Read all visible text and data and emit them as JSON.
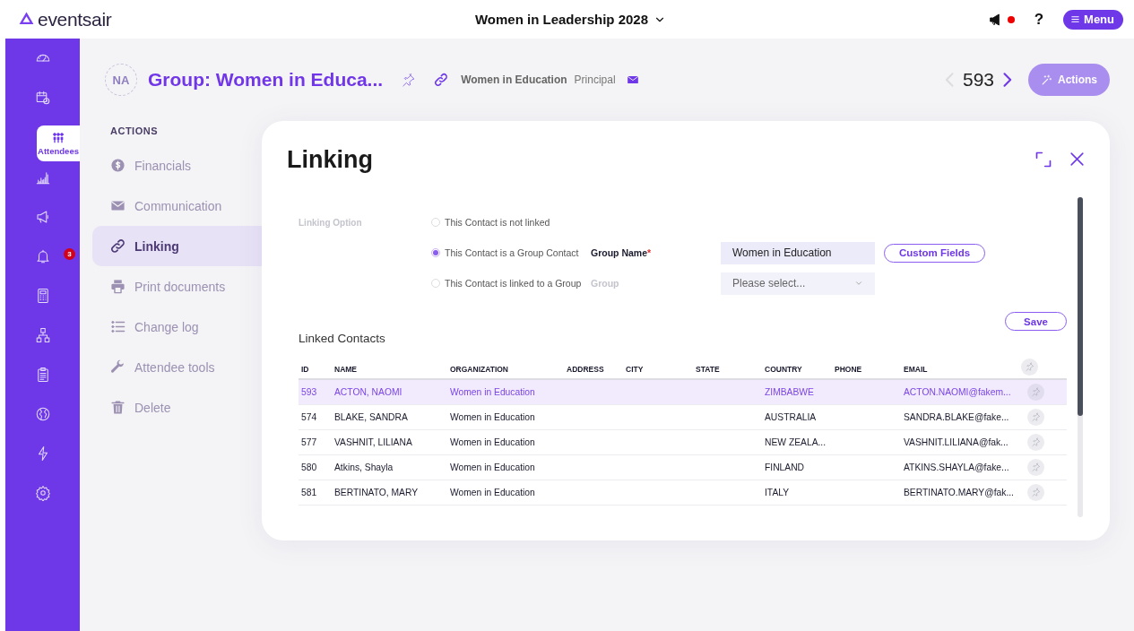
{
  "top_bar": {
    "logo": "eventsair",
    "event_title": "Women in Leadership 2028",
    "has_notification": true,
    "help": "?",
    "menu_button": "Menu"
  },
  "sidebar": {
    "items": [
      {
        "kind": "gauge",
        "selected": false
      },
      {
        "kind": "calendar",
        "selected": false
      },
      {
        "kind": "people",
        "label": "Attendees",
        "selected": true
      },
      {
        "kind": "chart",
        "selected": false
      },
      {
        "kind": "megaphone",
        "selected": false
      },
      {
        "kind": "bell",
        "badge": "3",
        "selected": false
      },
      {
        "kind": "calculator",
        "selected": false
      },
      {
        "kind": "hierarchy",
        "selected": false
      },
      {
        "kind": "clipboard",
        "selected": false
      },
      {
        "kind": "globe",
        "selected": false
      },
      {
        "kind": "bolt",
        "selected": false
      },
      {
        "kind": "gear",
        "selected": false
      }
    ]
  },
  "record": {
    "initials": "NA",
    "title": "Group: Women in Educa...",
    "organization": "Women in Education",
    "role": "Principal",
    "counter": "593",
    "previous_disabled": true,
    "next_disabled": false,
    "actions_button": "Actions",
    "actions_disabled": true
  },
  "actions_menu": {
    "heading": "ACTIONS",
    "items": [
      {
        "kind": "dollar",
        "label": "Financials",
        "selected": false
      },
      {
        "kind": "mail",
        "label": "Communication",
        "selected": false
      },
      {
        "kind": "link",
        "label": "Linking",
        "selected": true
      },
      {
        "kind": "print",
        "label": "Print documents",
        "selected": false
      },
      {
        "kind": "list",
        "label": "Change log",
        "selected": false
      },
      {
        "kind": "wrench",
        "label": "Attendee tools",
        "selected": false
      },
      {
        "kind": "trash",
        "label": "Delete",
        "selected": false
      }
    ]
  },
  "dialog": {
    "title": "Linking",
    "option_label": "Linking Option",
    "options": [
      {
        "label": "This Contact is not linked",
        "selected": false
      },
      {
        "label": "This Contact is a Group Contact",
        "selected": true,
        "field": {
          "kind": "text",
          "label": "Group Name",
          "required_mark": "*",
          "disabled": false,
          "value": "Women in Education",
          "button": "Custom Fields"
        }
      },
      {
        "label": "This Contact is linked to a Group",
        "selected": false,
        "field": {
          "kind": "select",
          "label": "Group",
          "disabled": true,
          "placeholder": "Please select..."
        }
      }
    ],
    "save_button": "Save",
    "linked_contacts_title": "Linked Contacts",
    "table": {
      "columns": [
        "ID",
        "NAME",
        "ORGANIZATION",
        "ADDRESS",
        "CITY",
        "STATE",
        "COUNTRY",
        "PHONE",
        "EMAIL"
      ],
      "rows": [
        {
          "selected": true,
          "cells": [
            "593",
            "ACTON, NAOMI",
            "Women in Education",
            "",
            "",
            "",
            "ZIMBABWE",
            "",
            "ACTON.NAOMI@fakem..."
          ]
        },
        {
          "selected": false,
          "cells": [
            "574",
            "BLAKE, SANDRA",
            "Women in Education",
            "",
            "",
            "",
            "AUSTRALIA",
            "",
            "SANDRA.BLAKE@fake..."
          ]
        },
        {
          "selected": false,
          "cells": [
            "577",
            "VASHNIT, LILIANA",
            "Women in Education",
            "",
            "",
            "",
            "NEW ZEALA...",
            "",
            "VASHNIT.LILIANA@fak..."
          ]
        },
        {
          "selected": false,
          "cells": [
            "580",
            "Atkins, Shayla",
            "Women in Education",
            "",
            "",
            "",
            "FINLAND",
            "",
            "ATKINS.SHAYLA@fake..."
          ]
        },
        {
          "selected": false,
          "cells": [
            "581",
            "BERTINATO, MARY",
            "Women in Education",
            "",
            "",
            "",
            "ITALY",
            "",
            "BERTINATO.MARY@fak..."
          ]
        }
      ]
    }
  }
}
